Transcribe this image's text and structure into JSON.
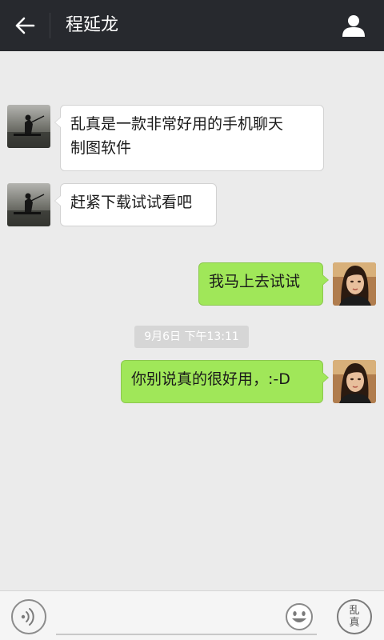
{
  "header": {
    "back_icon": "arrow-left-icon",
    "title": "程延龙",
    "profile_icon": "user-icon"
  },
  "messages": [
    {
      "side": "left",
      "text_line1": "乱真是一款非常好用的手机聊天",
      "text_line2": "制图软件"
    },
    {
      "side": "left",
      "text": "赶紧下载试试看吧"
    },
    {
      "side": "right",
      "text": "我马上去试试"
    },
    {
      "side": "right",
      "text": "你别说真的很好用，:-D"
    }
  ],
  "timestamp": "9月6日 下午13:11",
  "footer": {
    "voice_icon": "voice-icon",
    "emoji_icon": "smiley-icon",
    "logo_text_top": "乱",
    "logo_text_bottom": "真"
  },
  "colors": {
    "header_bg": "#27292e",
    "chat_bg": "#ebebeb",
    "sent_bubble": "#a0e759",
    "received_bubble": "#ffffff"
  }
}
